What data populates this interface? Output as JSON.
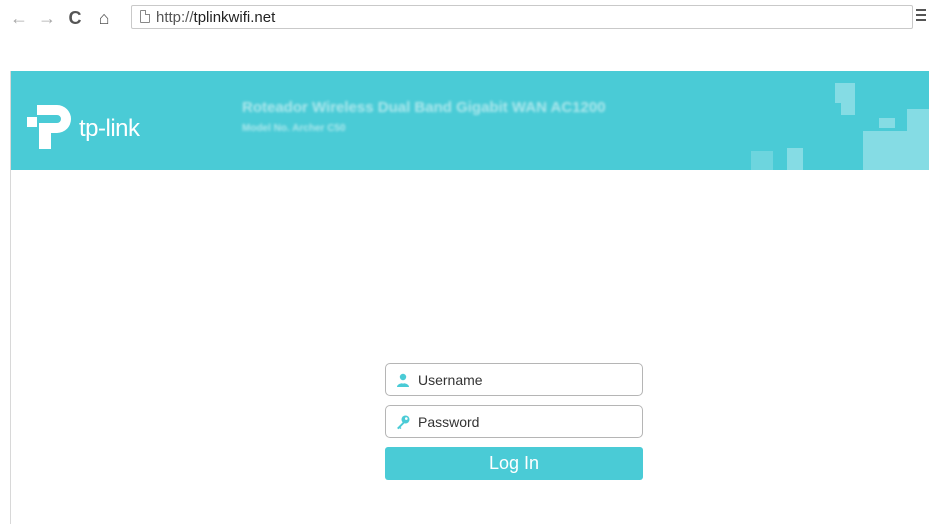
{
  "browser": {
    "back_glyph": "←",
    "forward_glyph": "→",
    "reload_glyph": "C",
    "home_glyph": "⌂",
    "url_scheme": "http://",
    "url_host": "tplinkwifi.net"
  },
  "header": {
    "brand": "tp-link",
    "product_title": "Roteador Wireless Dual Band Gigabit WAN AC1200",
    "model_number": "Model No. Archer C50",
    "accent_color": "#4acbd6"
  },
  "login": {
    "username_placeholder": "Username",
    "password_placeholder": "Password",
    "login_label": "Log In"
  },
  "icons": {
    "username": "user-icon",
    "password": "key-icon"
  }
}
